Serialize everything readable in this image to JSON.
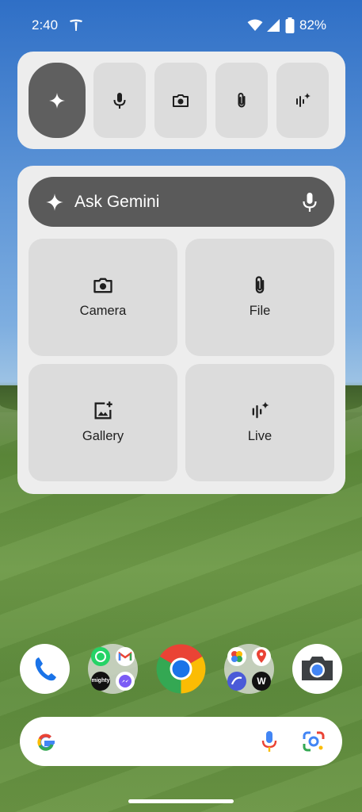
{
  "status_bar": {
    "time": "2:40",
    "battery": "82%",
    "icons": [
      "tesla-icon",
      "wifi-icon",
      "cellular-signal-icon",
      "battery-icon"
    ]
  },
  "quick_actions": {
    "tiles": [
      "gemini-spark-icon",
      "microphone-icon",
      "camera-icon",
      "attach-icon",
      "live-icon"
    ]
  },
  "gemini_widget": {
    "ask_label": "Ask Gemini",
    "cards": [
      {
        "label": "Camera",
        "icon": "camera-icon"
      },
      {
        "label": "File",
        "icon": "attach-icon"
      },
      {
        "label": "Gallery",
        "icon": "gallery-icon"
      },
      {
        "label": "Live",
        "icon": "live-icon"
      }
    ]
  },
  "dock": {
    "apps": [
      "phone-icon",
      "app-folder-1",
      "chrome-icon",
      "app-folder-2",
      "camera-app-icon"
    ],
    "folder1": [
      "whatsapp-icon",
      "gmail-icon",
      "mighty-icon",
      "messenger-icon"
    ],
    "folder1_text": {
      "mighty": "mighty"
    },
    "folder2": [
      "google-photos-icon",
      "google-maps-icon",
      "unknown-app-icon",
      "w-app-icon"
    ],
    "folder2_text": {
      "w": "W"
    }
  },
  "search": {
    "icons": [
      "google-g-icon",
      "google-mic-icon",
      "google-lens-icon"
    ]
  },
  "colors": {
    "widget_bg": "#ededed",
    "tile_bg": "#dcdcdc",
    "active_tile": "#5f5f5f"
  }
}
